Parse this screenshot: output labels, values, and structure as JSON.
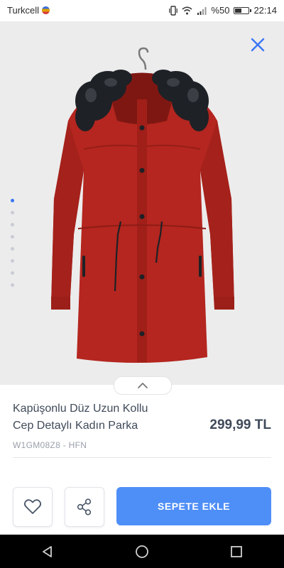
{
  "status_bar": {
    "carrier": "Turkcell",
    "battery_text": "%50",
    "battery_level": 0.5,
    "time": "22:14"
  },
  "gallery": {
    "page_count": 8,
    "active_index": 0,
    "colors": {
      "parka": "#b4261f",
      "fur": "#1e2126",
      "background": "#ececec"
    }
  },
  "product": {
    "title_line1": "Kapüşonlu Düz Uzun Kollu",
    "title_line2": "Cep Detaylı Kadın Parka",
    "price": "299,99 TL",
    "sku": "W1GM08Z8 - HFN"
  },
  "actions": {
    "add_to_cart": "SEPETE EKLE"
  },
  "colors": {
    "accent": "#4e8ef7",
    "text": "#3f4a5a"
  }
}
